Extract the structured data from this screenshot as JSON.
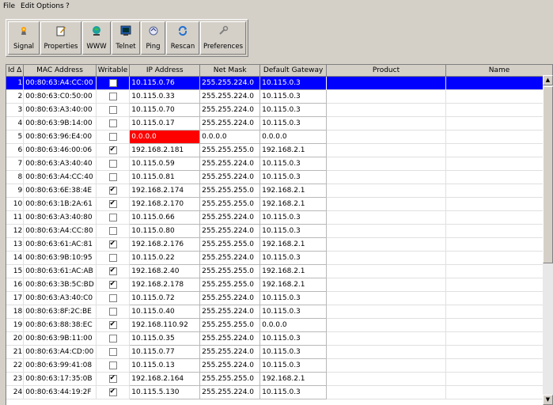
{
  "menu": [
    "File",
    "Edit",
    "Options",
    "?"
  ],
  "toolbar": [
    {
      "label": "Signal",
      "icon": "signal-icon"
    },
    {
      "label": "Properties",
      "icon": "properties-icon"
    },
    {
      "label": "WWW",
      "icon": "web-icon"
    },
    {
      "label": "Telnet",
      "icon": "telnet-icon"
    },
    {
      "label": "Ping",
      "icon": "ping-icon"
    },
    {
      "label": "Rescan",
      "icon": "rescan-icon"
    },
    {
      "label": "Preferences",
      "icon": "preferences-icon"
    }
  ],
  "columns": [
    "Id ∆",
    "MAC Address",
    "Writable",
    "IP Address",
    "Net Mask",
    "Default Gateway",
    "Product",
    "Name"
  ],
  "rows": [
    {
      "id": "1",
      "mac": "00:80:63:A4:CC:00",
      "w": false,
      "ip": "10.115.0.76",
      "mask": "255.255.224.0",
      "gw": "10.115.0.3",
      "sel": true
    },
    {
      "id": "2",
      "mac": "00:80:63:C0:50:00",
      "w": false,
      "ip": "10.115.0.33",
      "mask": "255.255.224.0",
      "gw": "10.115.0.3"
    },
    {
      "id": "3",
      "mac": "00:80:63:A3:40:00",
      "w": false,
      "ip": "10.115.0.70",
      "mask": "255.255.224.0",
      "gw": "10.115.0.3"
    },
    {
      "id": "4",
      "mac": "00:80:63:9B:14:00",
      "w": false,
      "ip": "10.115.0.17",
      "mask": "255.255.224.0",
      "gw": "10.115.0.3"
    },
    {
      "id": "5",
      "mac": "00:80:63:96:E4:00",
      "w": false,
      "ip": "0.0.0.0",
      "mask": "0.0.0.0",
      "gw": "0.0.0.0",
      "err": true
    },
    {
      "id": "6",
      "mac": "00:80:63:46:00:06",
      "w": true,
      "ip": "192.168.2.181",
      "mask": "255.255.255.0",
      "gw": "192.168.2.1"
    },
    {
      "id": "7",
      "mac": "00:80:63:A3:40:40",
      "w": false,
      "ip": "10.115.0.59",
      "mask": "255.255.224.0",
      "gw": "10.115.0.3"
    },
    {
      "id": "8",
      "mac": "00:80:63:A4:CC:40",
      "w": false,
      "ip": "10.115.0.81",
      "mask": "255.255.224.0",
      "gw": "10.115.0.3"
    },
    {
      "id": "9",
      "mac": "00:80:63:6E:38:4E",
      "w": true,
      "ip": "192.168.2.174",
      "mask": "255.255.255.0",
      "gw": "192.168.2.1"
    },
    {
      "id": "10",
      "mac": "00:80:63:1B:2A:61",
      "w": true,
      "ip": "192.168.2.170",
      "mask": "255.255.255.0",
      "gw": "192.168.2.1"
    },
    {
      "id": "11",
      "mac": "00:80:63:A3:40:80",
      "w": false,
      "ip": "10.115.0.66",
      "mask": "255.255.224.0",
      "gw": "10.115.0.3"
    },
    {
      "id": "12",
      "mac": "00:80:63:A4:CC:80",
      "w": false,
      "ip": "10.115.0.80",
      "mask": "255.255.224.0",
      "gw": "10.115.0.3"
    },
    {
      "id": "13",
      "mac": "00:80:63:61:AC:81",
      "w": true,
      "ip": "192.168.2.176",
      "mask": "255.255.255.0",
      "gw": "192.168.2.1"
    },
    {
      "id": "14",
      "mac": "00:80:63:9B:10:95",
      "w": false,
      "ip": "10.115.0.22",
      "mask": "255.255.224.0",
      "gw": "10.115.0.3"
    },
    {
      "id": "15",
      "mac": "00:80:63:61:AC:AB",
      "w": true,
      "ip": "192.168.2.40",
      "mask": "255.255.255.0",
      "gw": "192.168.2.1"
    },
    {
      "id": "16",
      "mac": "00:80:63:3B:5C:BD",
      "w": true,
      "ip": "192.168.2.178",
      "mask": "255.255.255.0",
      "gw": "192.168.2.1"
    },
    {
      "id": "17",
      "mac": "00:80:63:A3:40:C0",
      "w": false,
      "ip": "10.115.0.72",
      "mask": "255.255.224.0",
      "gw": "10.115.0.3"
    },
    {
      "id": "18",
      "mac": "00:80:63:8F:2C:BE",
      "w": false,
      "ip": "10.115.0.40",
      "mask": "255.255.224.0",
      "gw": "10.115.0.3"
    },
    {
      "id": "19",
      "mac": "00:80:63:88:38:EC",
      "w": true,
      "ip": "192.168.110.92",
      "mask": "255.255.255.0",
      "gw": "0.0.0.0"
    },
    {
      "id": "20",
      "mac": "00:80:63:9B:11:00",
      "w": false,
      "ip": "10.115.0.35",
      "mask": "255.255.224.0",
      "gw": "10.115.0.3"
    },
    {
      "id": "21",
      "mac": "00:80:63:A4:CD:00",
      "w": false,
      "ip": "10.115.0.77",
      "mask": "255.255.224.0",
      "gw": "10.115.0.3"
    },
    {
      "id": "22",
      "mac": "00:80:63:99:41:08",
      "w": false,
      "ip": "10.115.0.13",
      "mask": "255.255.224.0",
      "gw": "10.115.0.3"
    },
    {
      "id": "23",
      "mac": "00:80:63:17:35:0B",
      "w": true,
      "ip": "192.168.2.164",
      "mask": "255.255.255.0",
      "gw": "192.168.2.1"
    },
    {
      "id": "24",
      "mac": "00:80:63:44:19:2F",
      "w": true,
      "ip": "10.115.5.130",
      "mask": "255.255.224.0",
      "gw": "10.115.0.3"
    }
  ],
  "colors": {
    "selection": "#0000ff",
    "error": "#ff0000",
    "chrome": "#d4d0c8"
  }
}
